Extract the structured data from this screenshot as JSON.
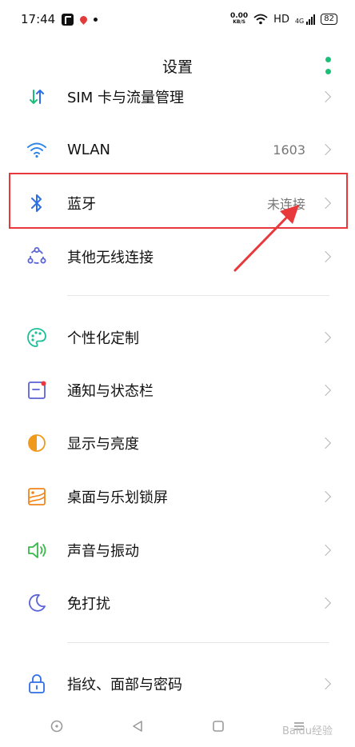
{
  "status_bar": {
    "time": "17:44",
    "net_speed_value": "0.00",
    "net_speed_unit": "KB/S",
    "hd_label": "HD",
    "signal_label": "4G",
    "battery_level": "82"
  },
  "header": {
    "title": "设置"
  },
  "settings": {
    "items": [
      {
        "label": "SIM 卡与流量管理",
        "value": "",
        "icon": "sim-data-icon"
      },
      {
        "label": "WLAN",
        "value": "1603",
        "icon": "wifi-icon"
      },
      {
        "label": "蓝牙",
        "value": "未连接",
        "icon": "bluetooth-icon"
      },
      {
        "label": "其他无线连接",
        "value": "",
        "icon": "wireless-connection-icon"
      },
      {
        "label": "个性化定制",
        "value": "",
        "icon": "palette-icon"
      },
      {
        "label": "通知与状态栏",
        "value": "",
        "icon": "notification-icon"
      },
      {
        "label": "显示与亮度",
        "value": "",
        "icon": "brightness-icon"
      },
      {
        "label": "桌面与乐划锁屏",
        "value": "",
        "icon": "wallpaper-icon"
      },
      {
        "label": "声音与振动",
        "value": "",
        "icon": "speaker-icon"
      },
      {
        "label": "免打扰",
        "value": "",
        "icon": "moon-icon"
      },
      {
        "label": "指纹、面部与密码",
        "value": "",
        "icon": "lock-icon"
      }
    ]
  },
  "colors": {
    "accent": "#1cbf7a",
    "highlight": "#e8383b"
  },
  "watermark": {
    "text": "Baidu经验"
  }
}
